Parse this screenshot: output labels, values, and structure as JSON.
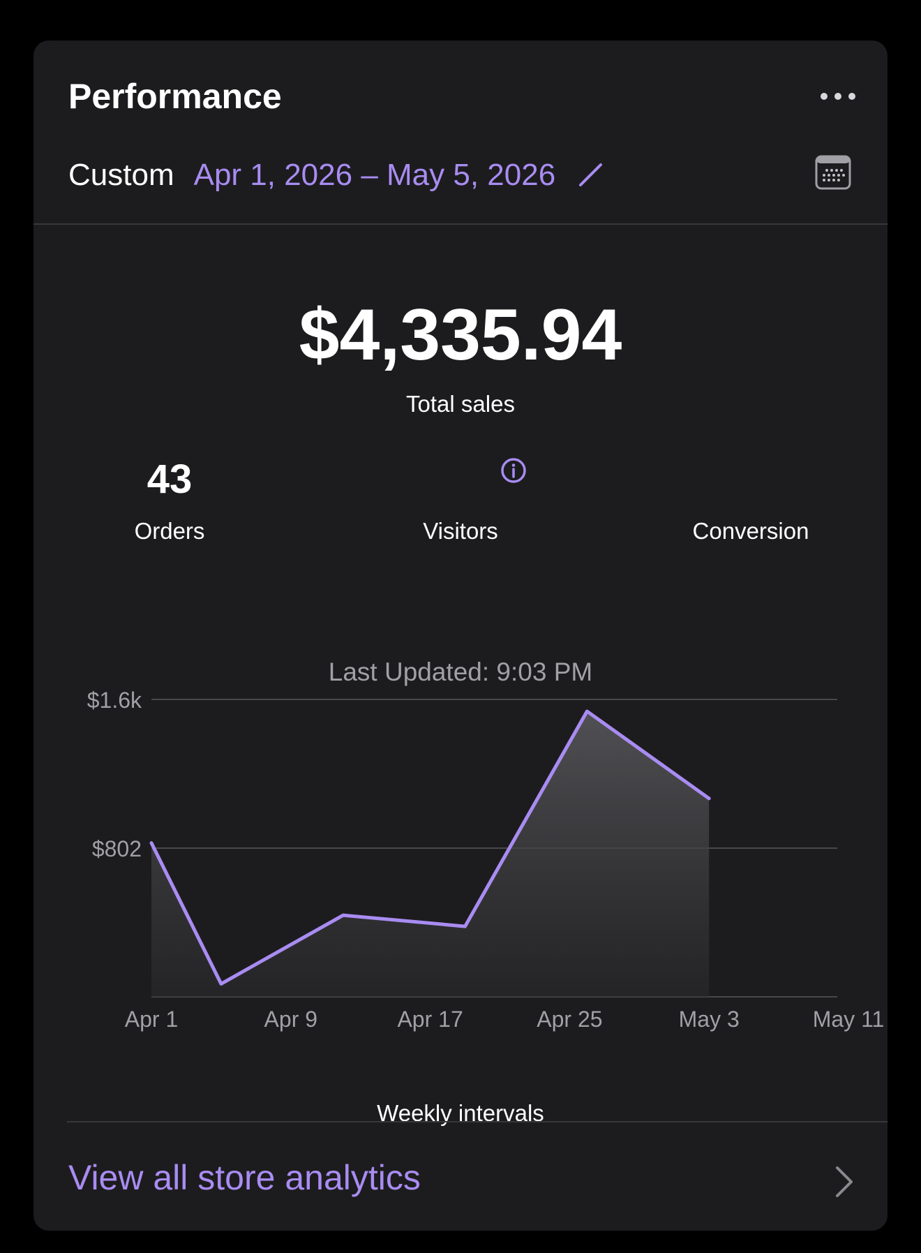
{
  "header": {
    "title": "Performance"
  },
  "date_range": {
    "label": "Custom",
    "value": "Apr 1, 2026 – May 5, 2026"
  },
  "summary": {
    "total_value": "$4,335.94",
    "total_label": "Total sales",
    "orders_value": "43",
    "orders_label": "Orders",
    "visitors_label": "Visitors",
    "conversion_label": "Conversion"
  },
  "last_updated": "Last Updated: 9:03 PM",
  "colors": {
    "accent": "#a98cf2",
    "card_bg": "#1c1c1e",
    "page_bg": "#000000"
  },
  "icons": {
    "more": "more-horizontal-icon",
    "edit": "pencil-icon",
    "calendar": "calendar-icon",
    "info": "info-icon",
    "chevron": "chevron-right-icon"
  },
  "chart_data": {
    "type": "area",
    "x": [
      "2026-04-01",
      "2026-04-05",
      "2026-04-12",
      "2026-04-19",
      "2026-04-26",
      "2026-05-03"
    ],
    "values": [
      830,
      70,
      440,
      380,
      1540,
      1070
    ],
    "xticks": [
      "Apr 1",
      "Apr 9",
      "Apr 17",
      "Apr 25",
      "May 3",
      "May 11"
    ],
    "xtick_dates": [
      "2026-04-01",
      "2026-04-09",
      "2026-04-17",
      "2026-04-25",
      "2026-05-03",
      "2026-05-11"
    ],
    "yticks": [
      "$1.6k",
      "$802"
    ],
    "ytick_values": [
      1604,
      802
    ],
    "ylim": [
      0,
      1604
    ],
    "xlabel": "Weekly intervals",
    "grid": true
  },
  "footer": {
    "link_label": "View all store analytics"
  }
}
